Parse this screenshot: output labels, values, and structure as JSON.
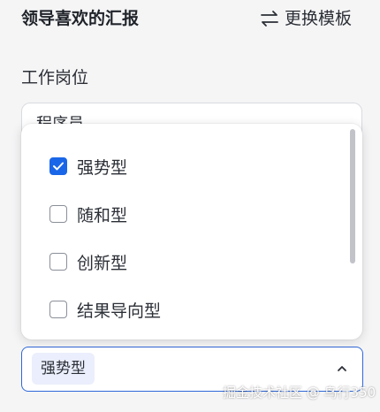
{
  "header": {
    "title": "领导喜欢的汇报",
    "switch_template_label": "更换模板"
  },
  "form": {
    "position_label": "工作岗位",
    "position_value": "程序员"
  },
  "select": {
    "selected_tag": "强势型"
  },
  "dropdown": {
    "options": [
      {
        "label": "强势型",
        "checked": true
      },
      {
        "label": "随和型",
        "checked": false
      },
      {
        "label": "创新型",
        "checked": false
      },
      {
        "label": "结果导向型",
        "checked": false
      }
    ]
  },
  "watermark": "掘金技术社区 @ 鸟行350",
  "colors": {
    "accent": "#1a66e8",
    "focus_border": "#2f68d8",
    "tag_background": "#ebeefc",
    "page_background": "#f5f5f6"
  },
  "icons": {
    "switch": "swap-arrows-icon",
    "checkmark": "check-icon",
    "select_arrow": "chevron-up-icon"
  }
}
